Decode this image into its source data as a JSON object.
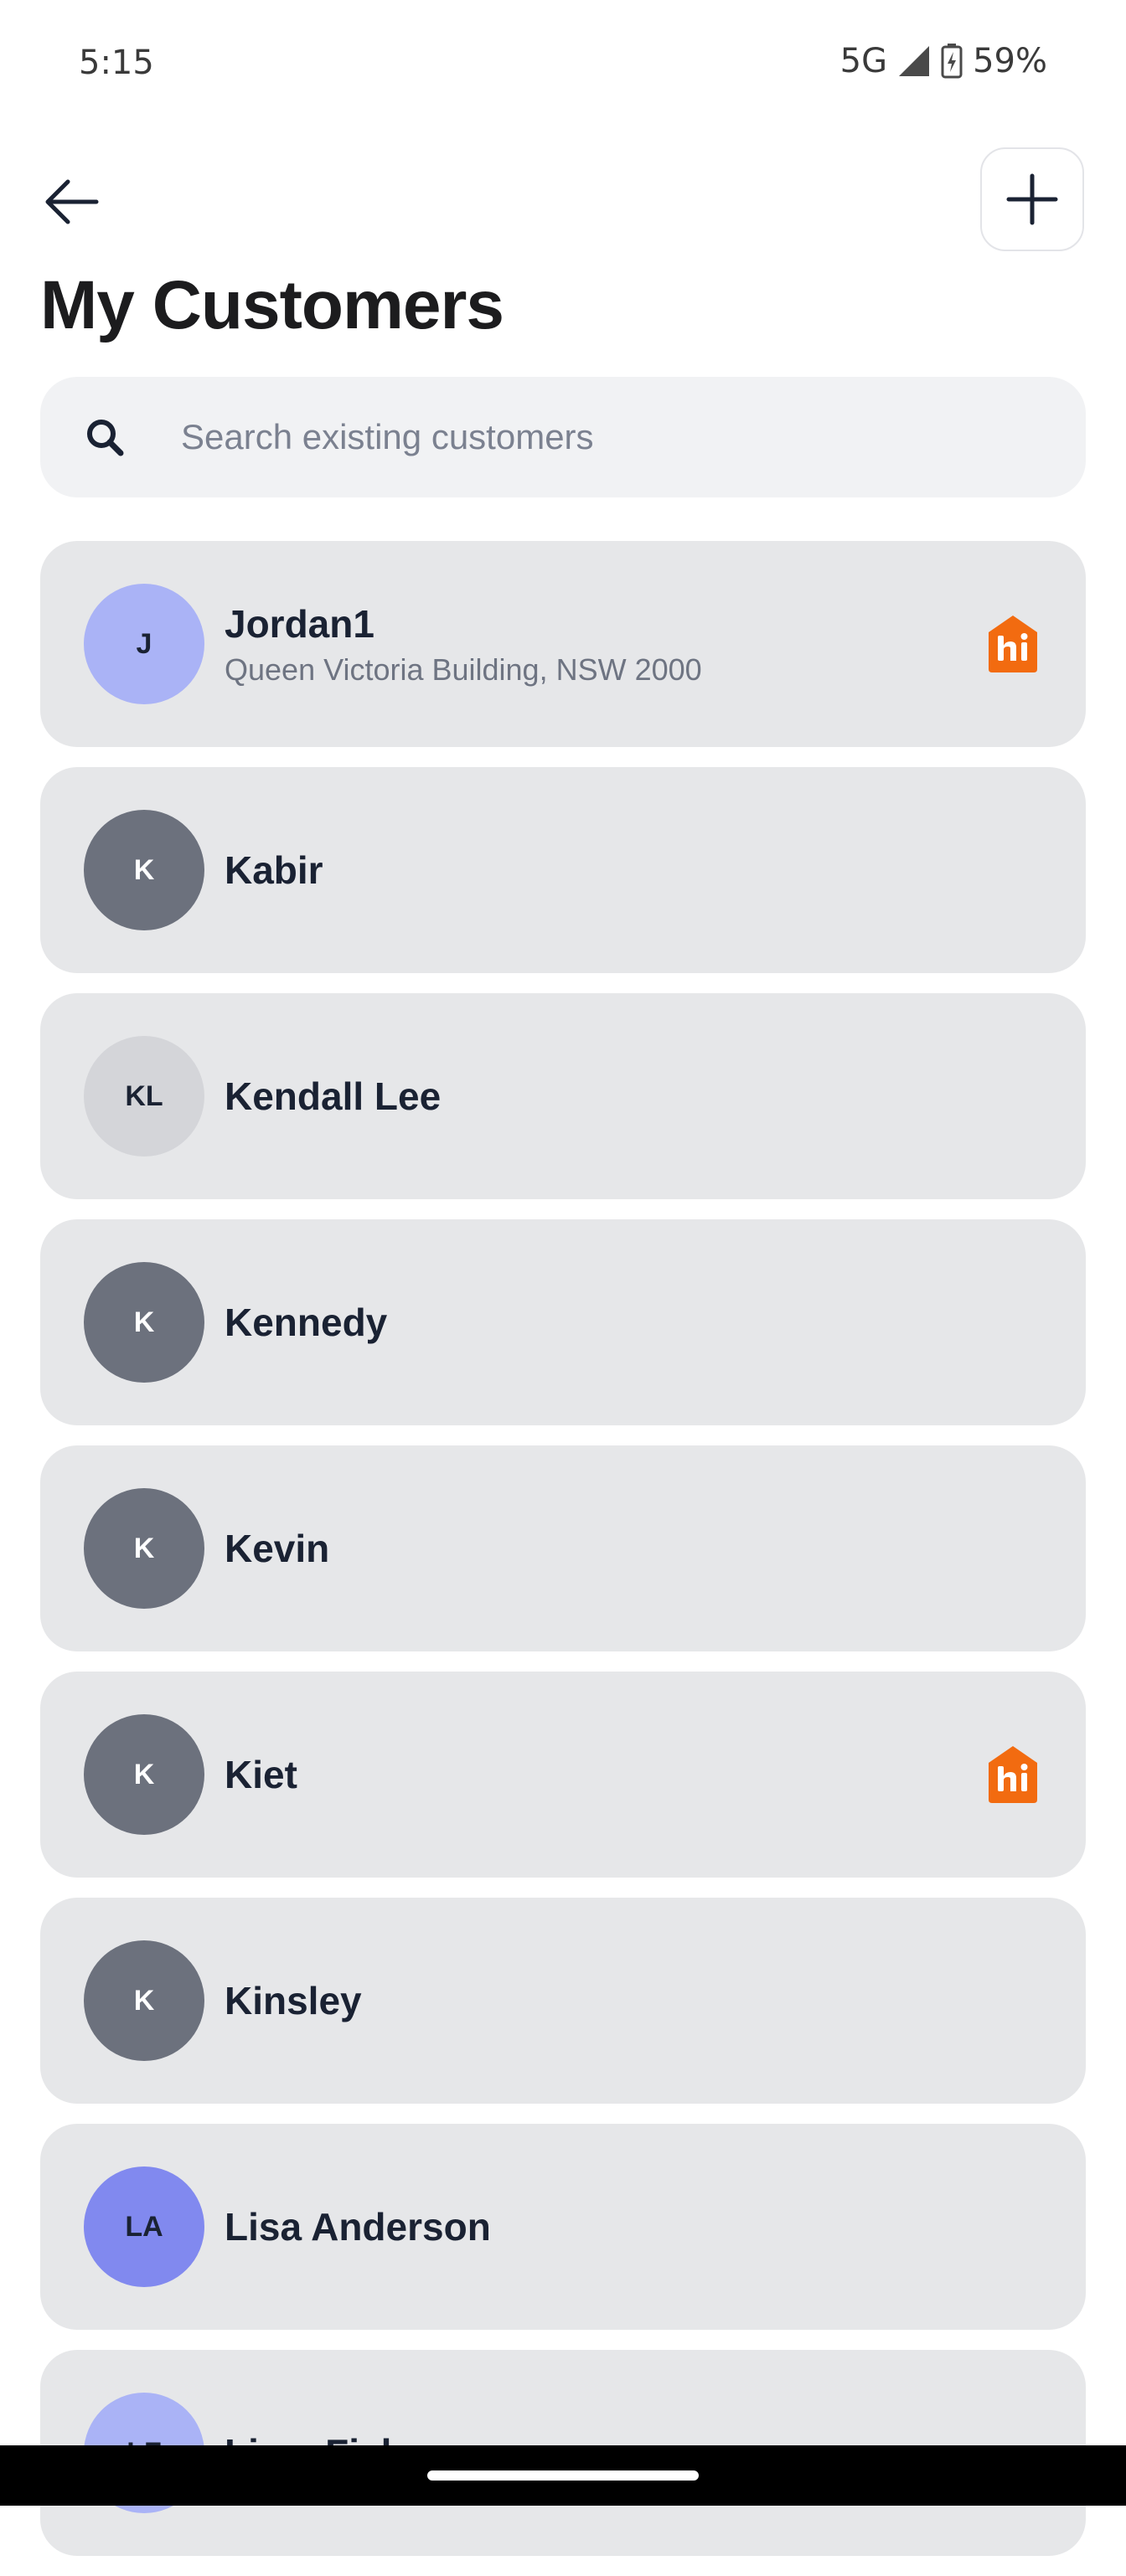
{
  "status_bar": {
    "time": "5:15",
    "network": "5G",
    "battery": "59%"
  },
  "header": {
    "title": "My Customers",
    "back_icon": "arrow-left-icon",
    "add_icon": "plus-icon"
  },
  "search": {
    "placeholder": "Search existing customers",
    "value": ""
  },
  "customers": [
    {
      "initials": "J",
      "name": "Jordan1",
      "address": "Queen Victoria Building, NSW 2000",
      "hipages": true,
      "avatar_color": "#aab3f6"
    },
    {
      "initials": "K",
      "name": "Kabir",
      "address": "",
      "hipages": false,
      "avatar_color": "#6c717d"
    },
    {
      "initials": "KL",
      "name": "Kendall Lee",
      "address": "",
      "hipages": false,
      "avatar_color": "#d4d5d9"
    },
    {
      "initials": "K",
      "name": "Kennedy",
      "address": "",
      "hipages": false,
      "avatar_color": "#6c717d"
    },
    {
      "initials": "K",
      "name": "Kevin",
      "address": "",
      "hipages": false,
      "avatar_color": "#6c717d"
    },
    {
      "initials": "K",
      "name": "Kiet",
      "address": "",
      "hipages": true,
      "avatar_color": "#6c717d"
    },
    {
      "initials": "K",
      "name": "Kinsley",
      "address": "",
      "hipages": false,
      "avatar_color": "#6c717d"
    },
    {
      "initials": "LA",
      "name": "Lisa Anderson",
      "address": "",
      "hipages": false,
      "avatar_color": "#8189ef"
    },
    {
      "initials": "LF",
      "name": "Liam Fisher",
      "address": "",
      "hipages": false,
      "avatar_color": "#aab3f6"
    }
  ],
  "colors": {
    "hipages_orange": "#f26b10",
    "card_bg": "#e6e7e9"
  }
}
